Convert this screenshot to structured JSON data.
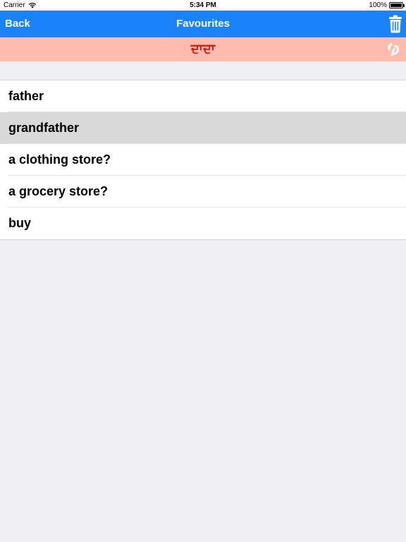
{
  "status_bar": {
    "carrier": "Carrier",
    "time": "5:34 PM",
    "battery": "100%"
  },
  "nav": {
    "back_label": "Back",
    "title": "Favourites",
    "trash_icon": "trash-icon"
  },
  "translation": {
    "text": "ਦਾਦਾ",
    "speak_icon": "speak-icon"
  },
  "favourites": [
    {
      "label": "father",
      "selected": false
    },
    {
      "label": "grandfather",
      "selected": true
    },
    {
      "label": "a clothing store?",
      "selected": false
    },
    {
      "label": "a grocery store?",
      "selected": false
    },
    {
      "label": "buy",
      "selected": false
    }
  ],
  "colors": {
    "nav_bg": "#1a82fb",
    "translation_bg": "#ffbcae",
    "translation_text": "#cc1a0c",
    "selected_row": "#d9d9d9",
    "background": "#efeff4"
  }
}
